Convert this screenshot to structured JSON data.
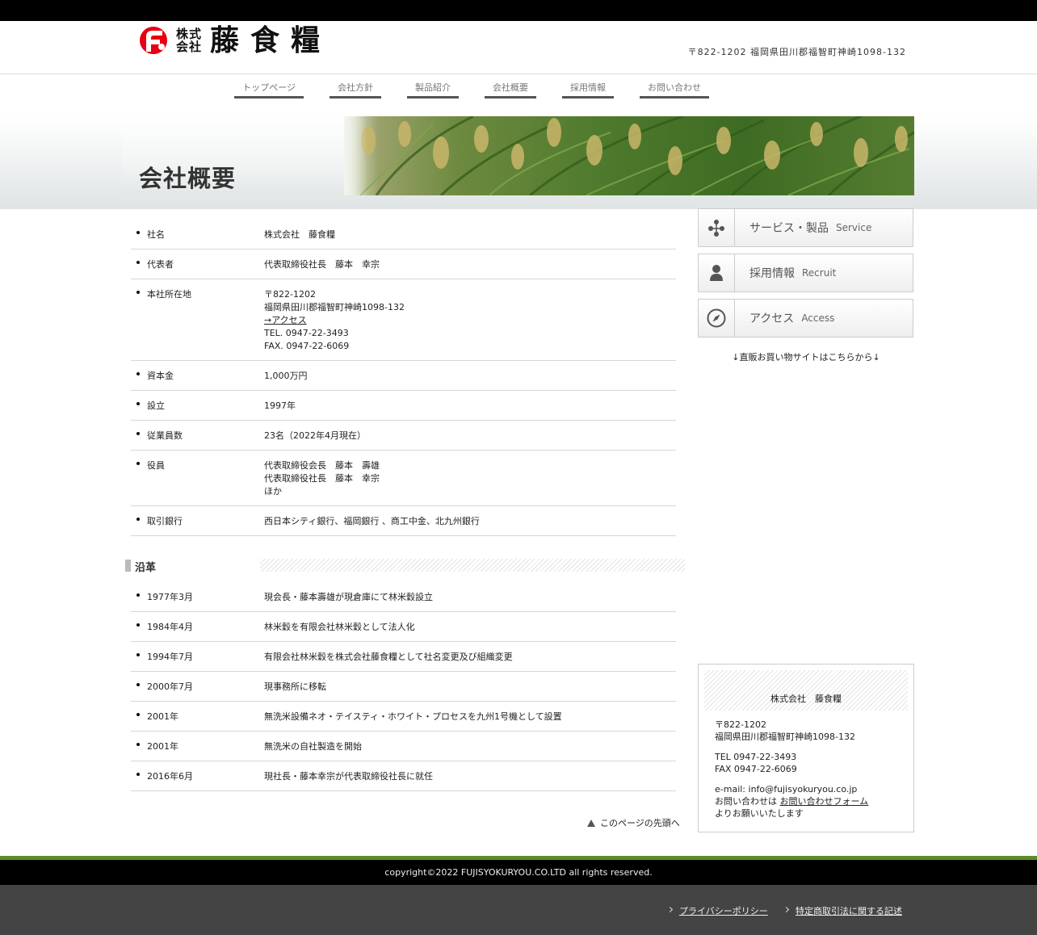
{
  "header": {
    "logo_kabu": "株式会社",
    "logo_name": "藤食糧",
    "address": "〒822-1202 福岡県田川郡福智町神崎1098-132"
  },
  "nav": [
    {
      "label": "トップページ"
    },
    {
      "label": "会社方針"
    },
    {
      "label": "製品紹介"
    },
    {
      "label": "会社概要"
    },
    {
      "label": "採用情報"
    },
    {
      "label": "お問い合わせ"
    }
  ],
  "page_title": "会社概要",
  "profile": [
    {
      "key": "社名",
      "lines": [
        "株式会社　藤食糧"
      ]
    },
    {
      "key": "代表者",
      "lines": [
        "代表取締役社長　藤本　幸宗"
      ]
    },
    {
      "key": "本社所在地",
      "lines": [
        "〒822-1202",
        "福岡県田川郡福智町神崎1098-132"
      ],
      "link": "→アクセス",
      "after": [
        "TEL. 0947-22-3493",
        "FAX. 0947-22-6069"
      ]
    },
    {
      "key": "資本金",
      "lines": [
        "1,000万円"
      ]
    },
    {
      "key": "設立",
      "lines": [
        "1997年"
      ]
    },
    {
      "key": "従業員数",
      "lines": [
        "23名（2022年4月現在）"
      ]
    },
    {
      "key": "役員",
      "lines": [
        "代表取締役会長　藤本　壽雄",
        "代表取締役社長　藤本　幸宗",
        "ほか"
      ]
    },
    {
      "key": "取引銀行",
      "lines": [
        "西日本シティ銀行、福岡銀行 、商工中金、北九州銀行"
      ]
    }
  ],
  "history_title": "沿革",
  "history": [
    {
      "date": "1977年3月",
      "text": "現会長・藤本壽雄が現倉庫にて林米穀設立"
    },
    {
      "date": "1984年4月",
      "text": "林米穀を有限会社林米穀として法人化"
    },
    {
      "date": "1994年7月",
      "text": "有限会社林米穀を株式会社藤食糧として社名変更及び組織変更"
    },
    {
      "date": "2000年7月",
      "text": "現事務所に移転"
    },
    {
      "date": "2001年",
      "text": "無洗米設備ネオ・テイスティ・ホワイト・プロセスを九州1号機として設置"
    },
    {
      "date": "2001年",
      "text": "無洗米の自社製造を開始"
    },
    {
      "date": "2016年6月",
      "text": "現社長・藤本幸宗が代表取締役社長に就任"
    }
  ],
  "page_top": "このページの先頭へ",
  "sidebar": {
    "buttons": [
      {
        "ja": "サービス・製品",
        "en": "Service",
        "icon": "network-icon"
      },
      {
        "ja": "採用情報",
        "en": "Recruit",
        "icon": "person-icon"
      },
      {
        "ja": "アクセス",
        "en": "Access",
        "icon": "compass-icon"
      }
    ],
    "shop_note": "↓直販お買い物サイトはこちらから↓",
    "info": {
      "title": "株式会社　藤食糧",
      "postal": "〒822-1202",
      "address": "福岡県田川郡福智町神崎1098-132",
      "tel": "TEL 0947-22-3493",
      "fax": "FAX 0947-22-6069",
      "email": "e-mail: info@fujisyokuryou.co.jp",
      "inquiry_prefix": "お問い合わせは ",
      "inquiry_link": "お問い合わせフォーム",
      "inquiry_suffix": "よりお願いいたします"
    }
  },
  "copyright": "copyright©2022 FUJISYOKURYOU.CO.LTD all rights reserved.",
  "footer_links": [
    {
      "label": "プライバシーポリシー"
    },
    {
      "label": "特定商取引法に関する記述"
    }
  ],
  "colors": {
    "accent_green": "#5b8d2a",
    "logo_red": "#e60012"
  }
}
